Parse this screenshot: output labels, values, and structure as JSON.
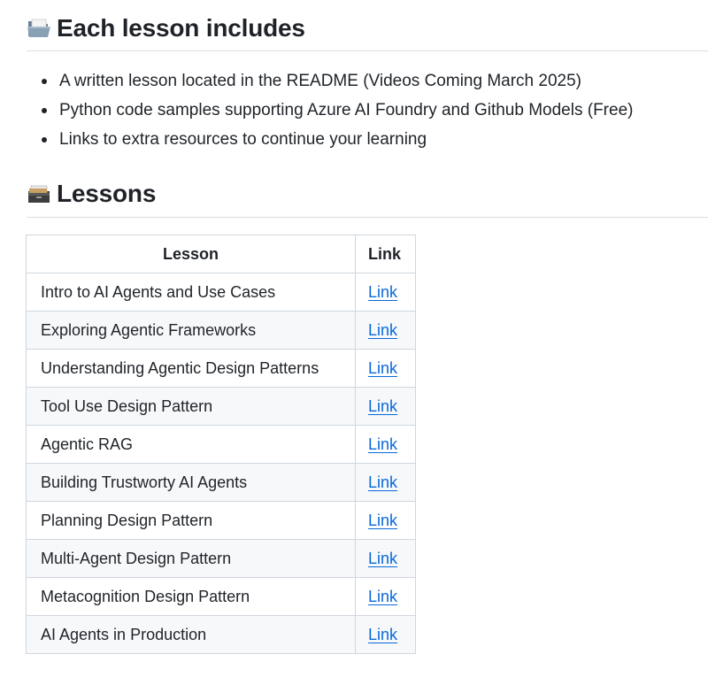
{
  "section1": {
    "icon": "open-folder-icon",
    "title": "Each lesson includes",
    "bullets": [
      "A written lesson located in the README (Videos Coming March 2025)",
      "Python code samples supporting Azure AI Foundry and Github Models (Free)",
      "Links to extra resources to continue your learning"
    ]
  },
  "section2": {
    "icon": "card-file-box-icon",
    "title": "Lessons"
  },
  "table": {
    "headers": {
      "lesson": "Lesson",
      "link": "Link"
    },
    "rows": [
      {
        "lesson": "Intro to AI Agents and Use Cases",
        "link": "Link"
      },
      {
        "lesson": "Exploring Agentic Frameworks",
        "link": "Link"
      },
      {
        "lesson": "Understanding Agentic Design Patterns",
        "link": "Link"
      },
      {
        "lesson": "Tool Use Design Pattern",
        "link": "Link"
      },
      {
        "lesson": "Agentic RAG",
        "link": "Link"
      },
      {
        "lesson": "Building Trustworty AI Agents",
        "link": "Link"
      },
      {
        "lesson": "Planning Design Pattern",
        "link": "Link"
      },
      {
        "lesson": "Multi-Agent Design Pattern",
        "link": "Link"
      },
      {
        "lesson": "Metacognition Design Pattern",
        "link": "Link"
      },
      {
        "lesson": "AI Agents in Production",
        "link": "Link"
      }
    ]
  },
  "colors": {
    "text": "#1f2328",
    "link": "#0969da",
    "border": "#d0d7de",
    "row_alt": "#f6f8fa"
  }
}
